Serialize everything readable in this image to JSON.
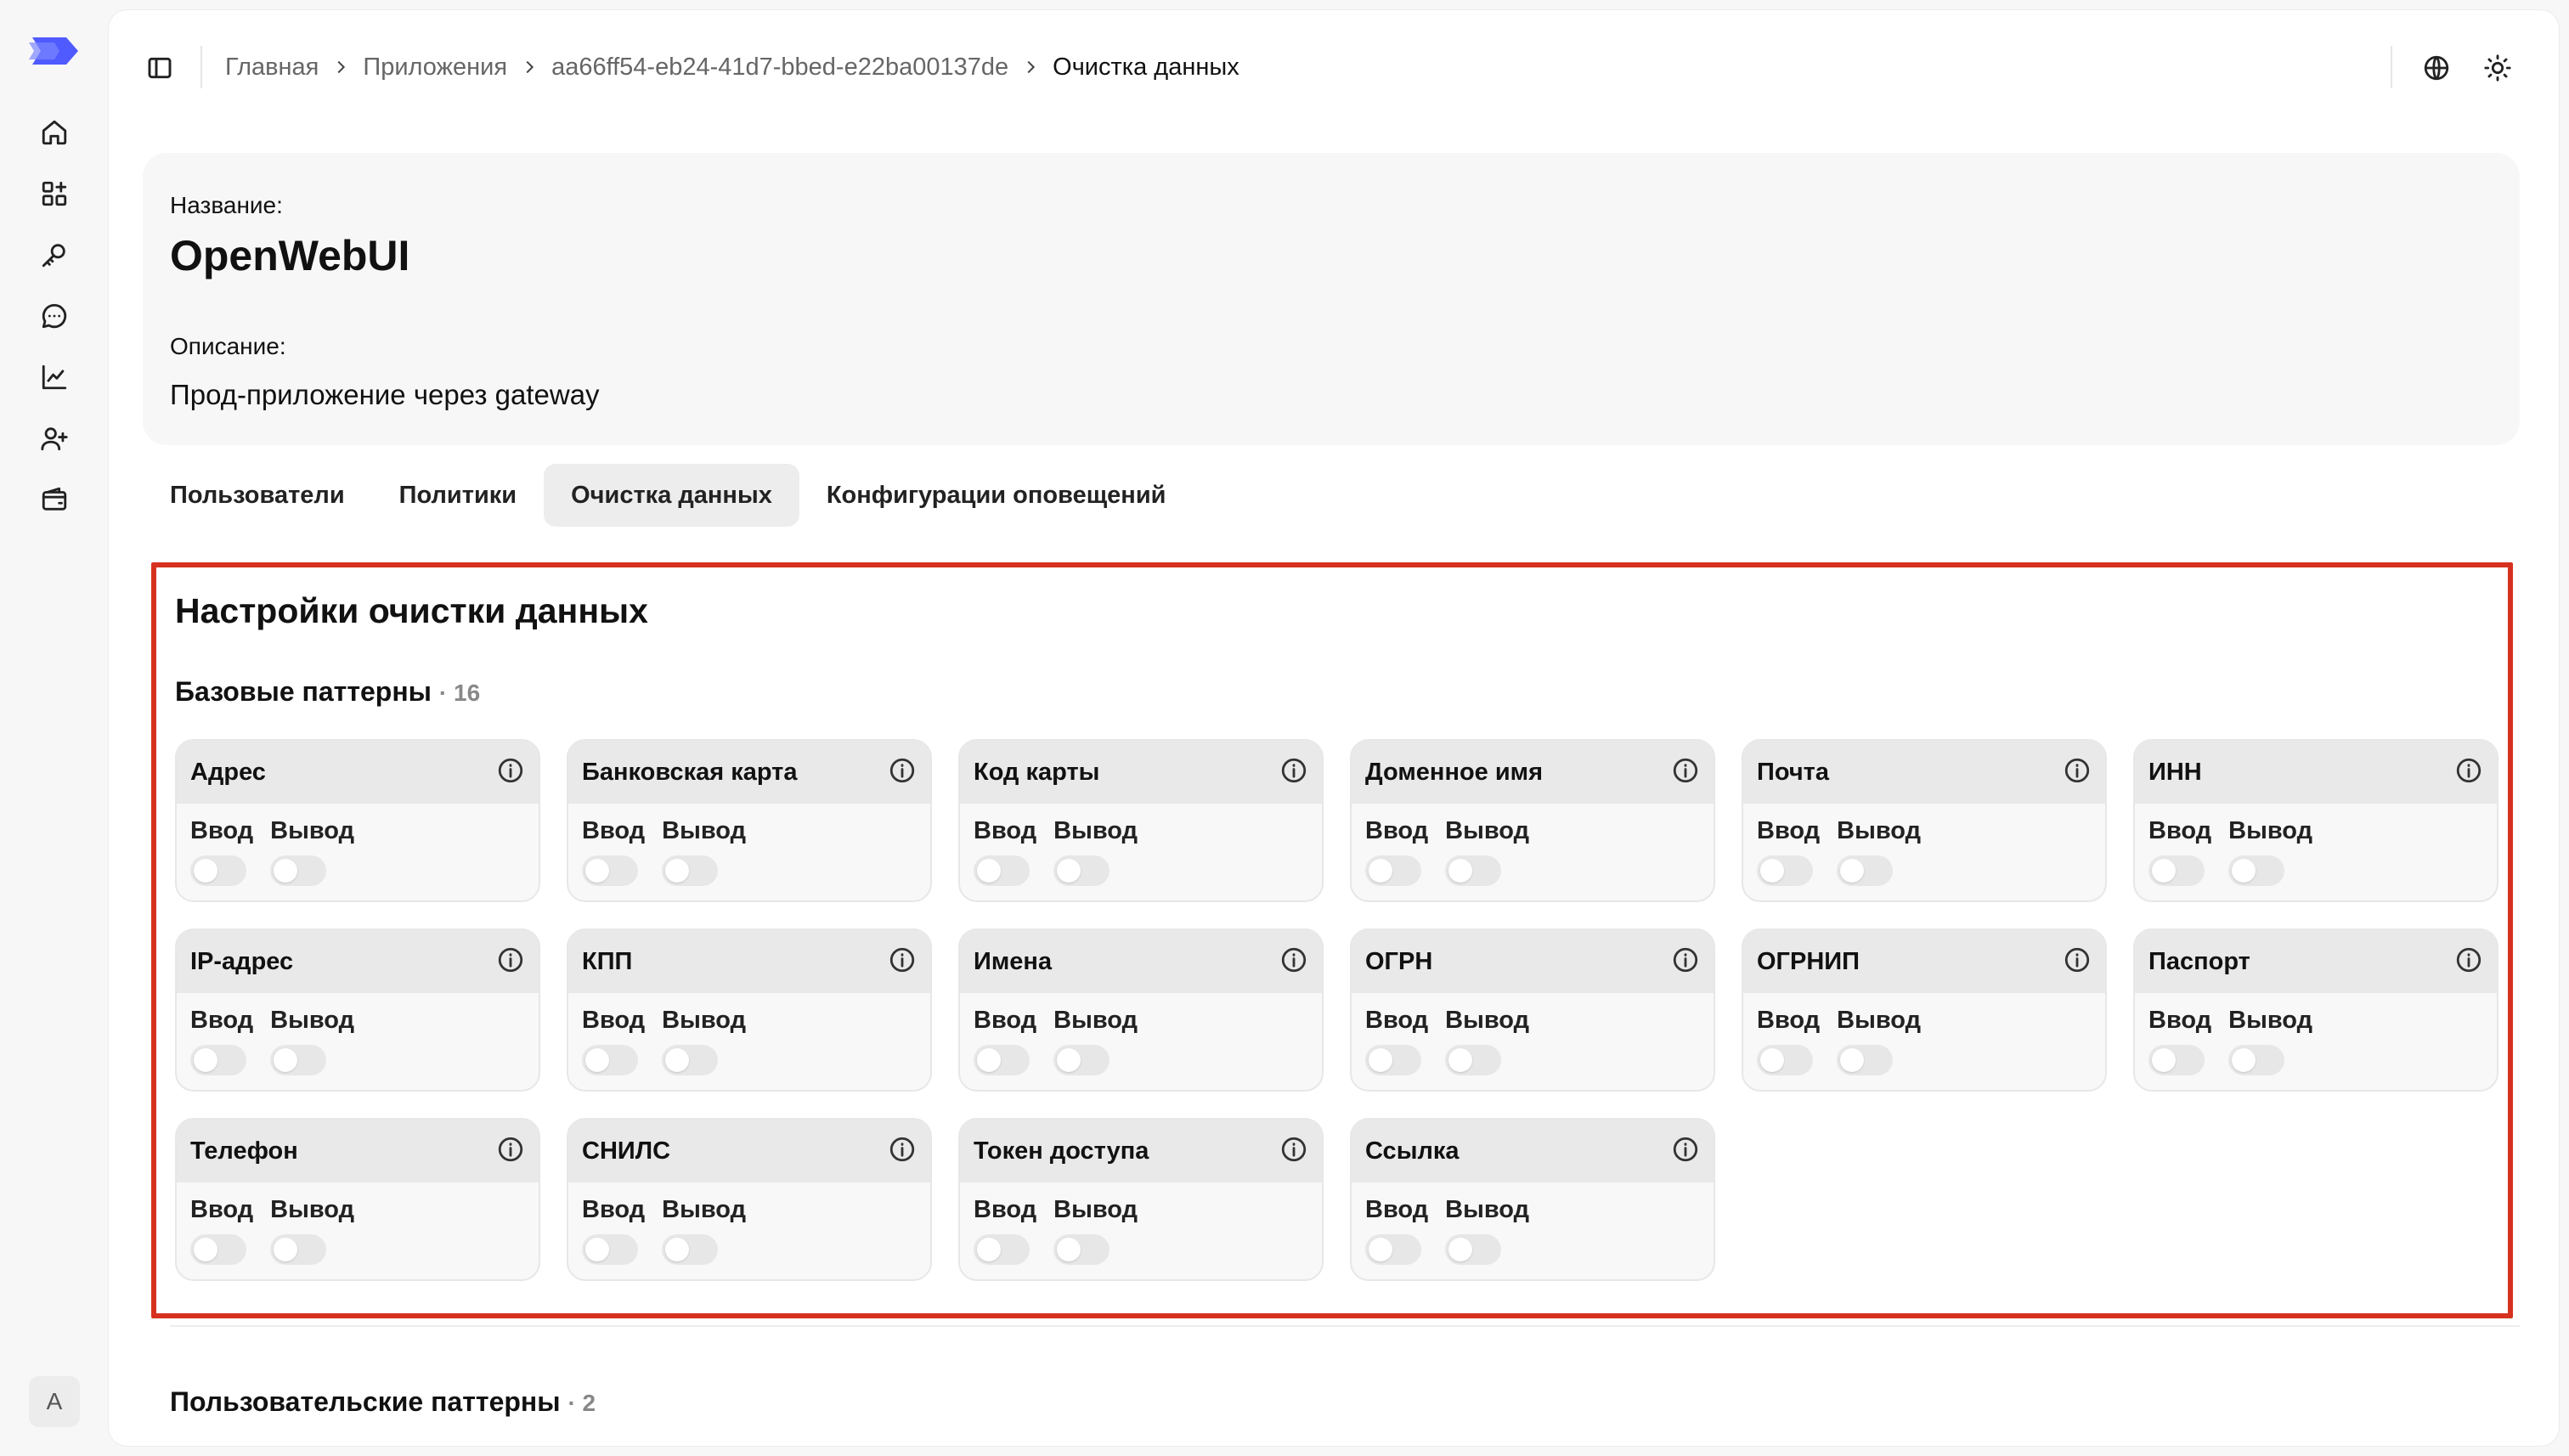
{
  "nav": {
    "items": [
      {
        "name": "home-icon"
      },
      {
        "name": "apps-icon"
      },
      {
        "name": "key-icon"
      },
      {
        "name": "chat-icon"
      },
      {
        "name": "chart-icon"
      },
      {
        "name": "user-add-icon"
      },
      {
        "name": "wallet-icon"
      }
    ],
    "avatar_initial": "A"
  },
  "breadcrumb": [
    "Главная",
    "Приложения",
    "aa66ff54-eb24-41d7-bbed-e22ba00137de",
    "Очистка данных"
  ],
  "app": {
    "name_label": "Название:",
    "name": "OpenWebUI",
    "desc_label": "Описание:",
    "description": "Прод-приложение через gateway"
  },
  "tabs": [
    {
      "label": "Пользователи",
      "active": false
    },
    {
      "label": "Политики",
      "active": false
    },
    {
      "label": "Очистка данных",
      "active": true
    },
    {
      "label": "Конфигурации оповещений",
      "active": false
    }
  ],
  "sanitize": {
    "title": "Настройки очистки данных",
    "base_label": "Базовые паттерны",
    "base_count": "· 16",
    "input_label": "Ввод",
    "output_label": "Вывод",
    "patterns": [
      {
        "name": "Адрес",
        "input": false,
        "output": false
      },
      {
        "name": "Банковская карта",
        "input": false,
        "output": false
      },
      {
        "name": "Код карты",
        "input": false,
        "output": false
      },
      {
        "name": "Доменное имя",
        "input": false,
        "output": false
      },
      {
        "name": "Почта",
        "input": false,
        "output": false
      },
      {
        "name": "ИНН",
        "input": false,
        "output": false
      },
      {
        "name": "IP-адрес",
        "input": false,
        "output": false
      },
      {
        "name": "КПП",
        "input": false,
        "output": false
      },
      {
        "name": "Имена",
        "input": false,
        "output": false
      },
      {
        "name": "ОГРН",
        "input": false,
        "output": false
      },
      {
        "name": "ОГРНИП",
        "input": false,
        "output": false
      },
      {
        "name": "Паспорт",
        "input": false,
        "output": false
      },
      {
        "name": "Телефон",
        "input": false,
        "output": false
      },
      {
        "name": "СНИЛС",
        "input": false,
        "output": false
      },
      {
        "name": "Токен доступа",
        "input": false,
        "output": false
      },
      {
        "name": "Ссылка",
        "input": false,
        "output": false
      }
    ],
    "custom_label": "Пользовательские паттерны",
    "custom_count": "· 2"
  },
  "colors": {
    "accent": "#4f5bff",
    "highlight_border": "#d6311f"
  }
}
